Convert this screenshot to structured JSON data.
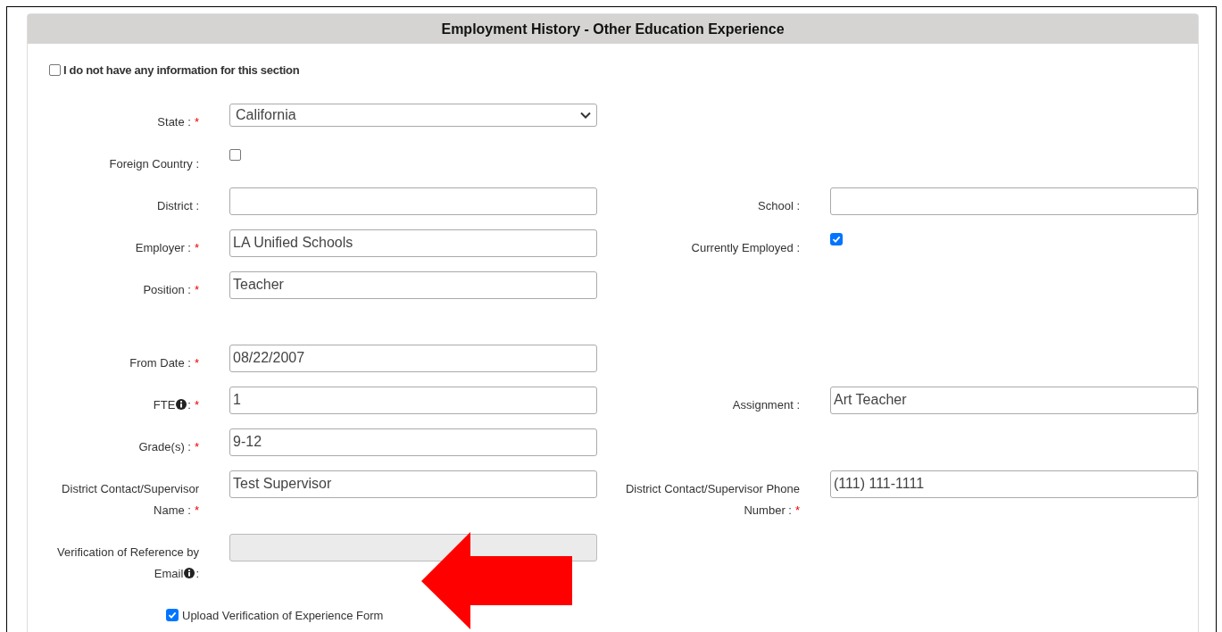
{
  "panel": {
    "title": "Employment History - Other Education Experience"
  },
  "no_info": {
    "label": "I do not have any information for this section",
    "checked": false
  },
  "groups": [
    [
      {
        "left": {
          "kind": "select",
          "label": "State :",
          "required_mark": "*",
          "value": "California"
        }
      },
      {
        "left": {
          "kind": "checkbox",
          "label": "Foreign Country :",
          "checked": false
        }
      },
      {
        "left": {
          "kind": "text",
          "label": "District :"
        },
        "right": {
          "kind": "text",
          "label": "School :"
        }
      },
      {
        "left": {
          "kind": "text",
          "label": "Employer :",
          "required_mark": "*",
          "value": "LA Unified Schools"
        },
        "right": {
          "kind": "checkbox",
          "label": "Currently Employed :",
          "checked": true
        }
      },
      {
        "left": {
          "kind": "text",
          "label": "Position :",
          "required_mark": "*",
          "value": "Teacher"
        }
      }
    ],
    [
      {
        "left": {
          "kind": "text",
          "label": "From Date :",
          "required_mark": "*",
          "value": "08/22/2007"
        }
      },
      {
        "left": {
          "kind": "text",
          "label": "FTE",
          "info": true,
          "after_info": ":",
          "required_mark": "*",
          "value": "1"
        },
        "right": {
          "kind": "text",
          "label": "Assignment :",
          "value": "Art Teacher"
        }
      },
      {
        "left": {
          "kind": "text",
          "label": "Grade(s) :",
          "required_mark": "*",
          "value": "9-12"
        }
      },
      {
        "left": {
          "kind": "text",
          "label": "District Contact/Supervisor Name :",
          "required_mark": "*",
          "value": "Test Supervisor"
        },
        "right": {
          "kind": "text",
          "label": "District Contact/Supervisor Phone Number :",
          "required_mark": "*",
          "value": "(111) 111-1111"
        }
      },
      {
        "left": {
          "kind": "disabled",
          "label": "Verification of Reference by Email",
          "info": true,
          "after_info": ":"
        }
      }
    ]
  ],
  "upload": {
    "label": "Upload Verification of Experience Form",
    "checked": true
  }
}
